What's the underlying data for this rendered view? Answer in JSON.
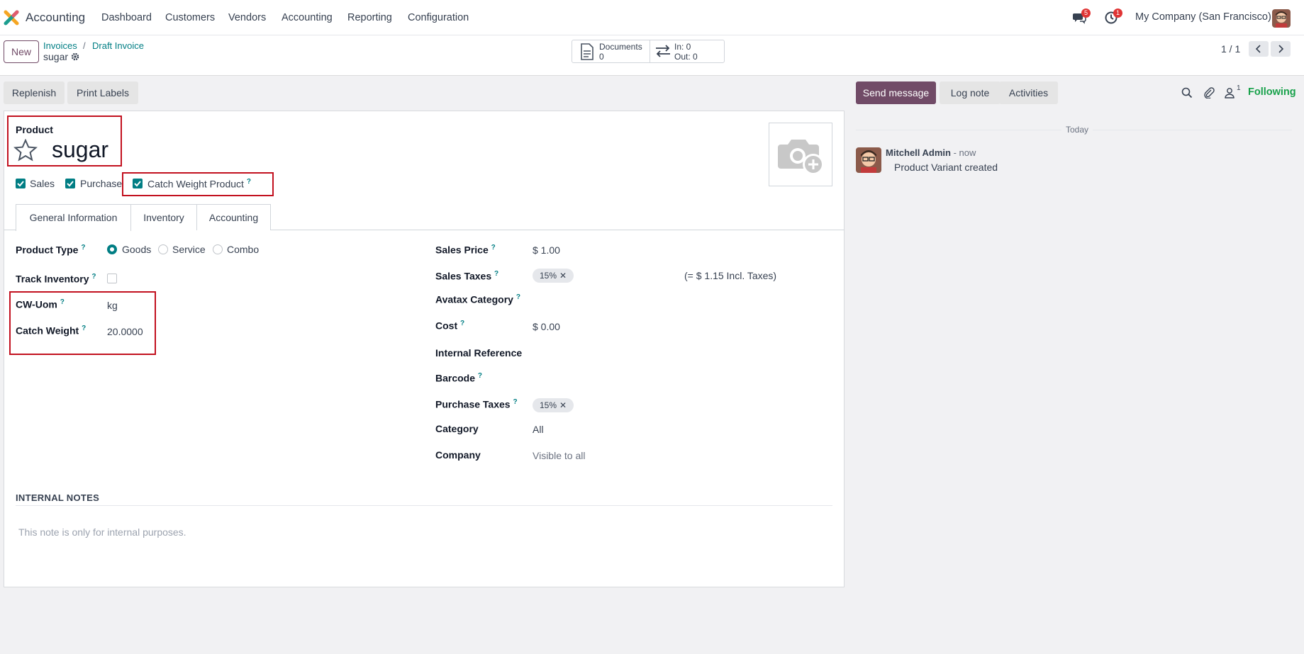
{
  "app": {
    "name": "Accounting",
    "menu": [
      "Dashboard",
      "Customers",
      "Vendors",
      "Accounting",
      "Reporting",
      "Configuration"
    ],
    "messages_badge": "5",
    "activities_badge": "1",
    "company": "My Company (San Francisco)"
  },
  "control": {
    "new_label": "New",
    "breadcrumb": [
      "Invoices",
      "Draft Invoice"
    ],
    "breadcrumb_sep": "/",
    "current": "sugar",
    "documents_label": "Documents",
    "documents_count": "0",
    "in_label": "In: 0",
    "out_label": "Out: 0",
    "pager": "1 / 1"
  },
  "actions": {
    "replenish": "Replenish",
    "print_labels": "Print Labels"
  },
  "form": {
    "product_label": "Product",
    "product_name": "sugar",
    "checkboxes": {
      "sales": "Sales",
      "purchase": "Purchase",
      "catch_weight": "Catch Weight Product"
    },
    "tabs": [
      "General Information",
      "Inventory",
      "Accounting"
    ],
    "left": {
      "product_type_label": "Product Type",
      "product_type_options": [
        "Goods",
        "Service",
        "Combo"
      ],
      "product_type_selected": "Goods",
      "track_inventory_label": "Track Inventory",
      "cw_uom_label": "CW-Uom",
      "cw_uom_value": "kg",
      "catch_weight_label": "Catch Weight",
      "catch_weight_value": "20.0000"
    },
    "right": {
      "sales_price_label": "Sales Price",
      "sales_price_value": "$ 1.00",
      "sales_taxes_label": "Sales Taxes",
      "sales_taxes_tag": "15%",
      "sales_taxes_incl": "(= $ 1.15 Incl. Taxes)",
      "avatax_label": "Avatax Category",
      "cost_label": "Cost",
      "cost_value": "$ 0.00",
      "internal_ref_label": "Internal Reference",
      "barcode_label": "Barcode",
      "purchase_taxes_label": "Purchase Taxes",
      "purchase_taxes_tag": "15%",
      "category_label": "Category",
      "category_value": "All",
      "company_label": "Company",
      "company_value": "Visible to all"
    },
    "notes_title": "INTERNAL NOTES",
    "notes_placeholder": "This note is only for internal purposes."
  },
  "chatter": {
    "send_message": "Send message",
    "log_note": "Log note",
    "activities": "Activities",
    "followers_count": "1",
    "following": "Following",
    "today": "Today",
    "message": {
      "author": "Mitchell Admin",
      "time": "- now",
      "body": "Product Variant created"
    }
  },
  "colors": {
    "brand": "#714b67",
    "accent": "#017e84",
    "highlight_box": "#c2111f",
    "following": "#17a14a"
  }
}
